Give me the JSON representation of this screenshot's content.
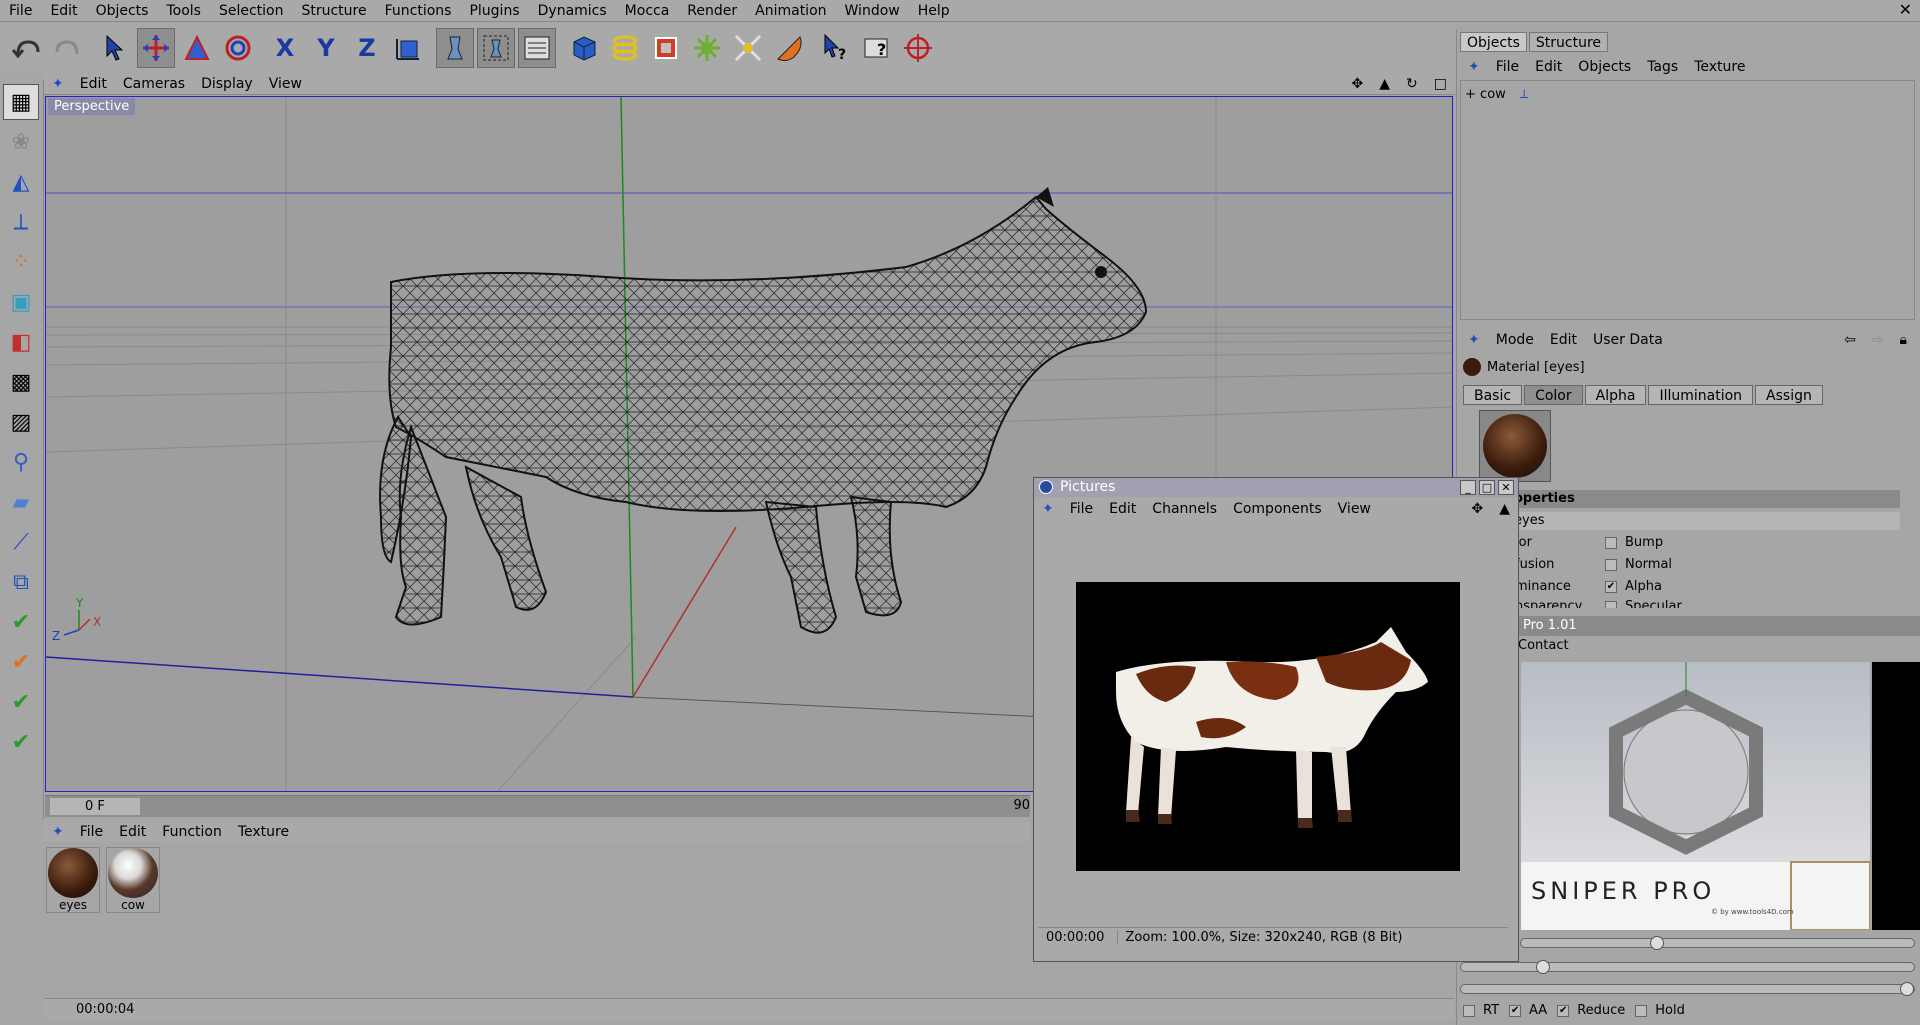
{
  "menubar": {
    "items": [
      "File",
      "Edit",
      "Objects",
      "Tools",
      "Selection",
      "Structure",
      "Functions",
      "Plugins",
      "Dynamics",
      "Mocca",
      "Render",
      "Animation",
      "Window",
      "Help"
    ],
    "close": "✕"
  },
  "toolbar": {
    "icons": [
      "undo-icon",
      "redo-icon",
      "select-arrow-icon",
      "move-icon",
      "scale-icon",
      "rotate-icon",
      "x-axis-lock-icon",
      "y-axis-lock-icon",
      "z-axis-lock-icon",
      "world-coordinates-icon",
      "render-view-icon",
      "render-region-icon",
      "render-settings-icon",
      "cube-primitive-icon",
      "spline-icon",
      "nurbs-icon",
      "modeling-icon",
      "deformer-icon",
      "scene-icon",
      "light-icon",
      "help-pointer-icon",
      "help-icon",
      "target-icon"
    ]
  },
  "viewport": {
    "menu": [
      "Edit",
      "Cameras",
      "Display",
      "View"
    ],
    "label": "Perspective",
    "axes": {
      "y": "Y",
      "z": "Z",
      "x": "X"
    }
  },
  "timeline": {
    "frame": "0 F",
    "end": "90"
  },
  "materials": {
    "menu": [
      "File",
      "Edit",
      "Function",
      "Texture"
    ],
    "items": [
      {
        "name": "eyes"
      },
      {
        "name": "cow"
      }
    ]
  },
  "status": {
    "time": "00:00:04"
  },
  "objects_panel": {
    "tabs": [
      "Objects",
      "Structure"
    ],
    "menu": [
      "File",
      "Edit",
      "Objects",
      "Tags",
      "Texture"
    ],
    "tree": [
      {
        "name": "cow",
        "expander": "+"
      }
    ]
  },
  "attributes": {
    "menu": [
      "Mode",
      "Edit",
      "User Data"
    ],
    "title": "Material [eyes]",
    "tabs": [
      "Basic",
      "Color",
      "Alpha",
      "Illumination",
      "Assign"
    ],
    "active_tab": "Color",
    "section": "operties",
    "name_row": "eyes",
    "props_left": [
      "lor",
      "fusion",
      "minance",
      "nsparency"
    ],
    "props_right": [
      {
        "label": "Bump",
        "checked": false
      },
      {
        "label": "Normal",
        "checked": false
      },
      {
        "label": "Alpha",
        "checked": true
      },
      {
        "label": "Specular",
        "checked": false
      }
    ]
  },
  "pictures_window": {
    "title": "Pictures",
    "menu": [
      "File",
      "Edit",
      "Channels",
      "Components",
      "View"
    ],
    "status_time": "00:00:00",
    "status_info": "Zoom: 100.0%, Size: 320x240, RGB (8 Bit)"
  },
  "plugin_panel": {
    "title": "Pro 1.01",
    "menu_item": "Contact",
    "banner": "SNIPER PRO",
    "copyright": "© by www.tools4D.com",
    "sliders": [
      0.34,
      0.17,
      1.0
    ],
    "options": [
      {
        "label": "RT",
        "checked": false
      },
      {
        "label": "AA",
        "checked": true
      },
      {
        "label": "Reduce",
        "checked": true
      },
      {
        "label": "Hold",
        "checked": false
      }
    ]
  }
}
